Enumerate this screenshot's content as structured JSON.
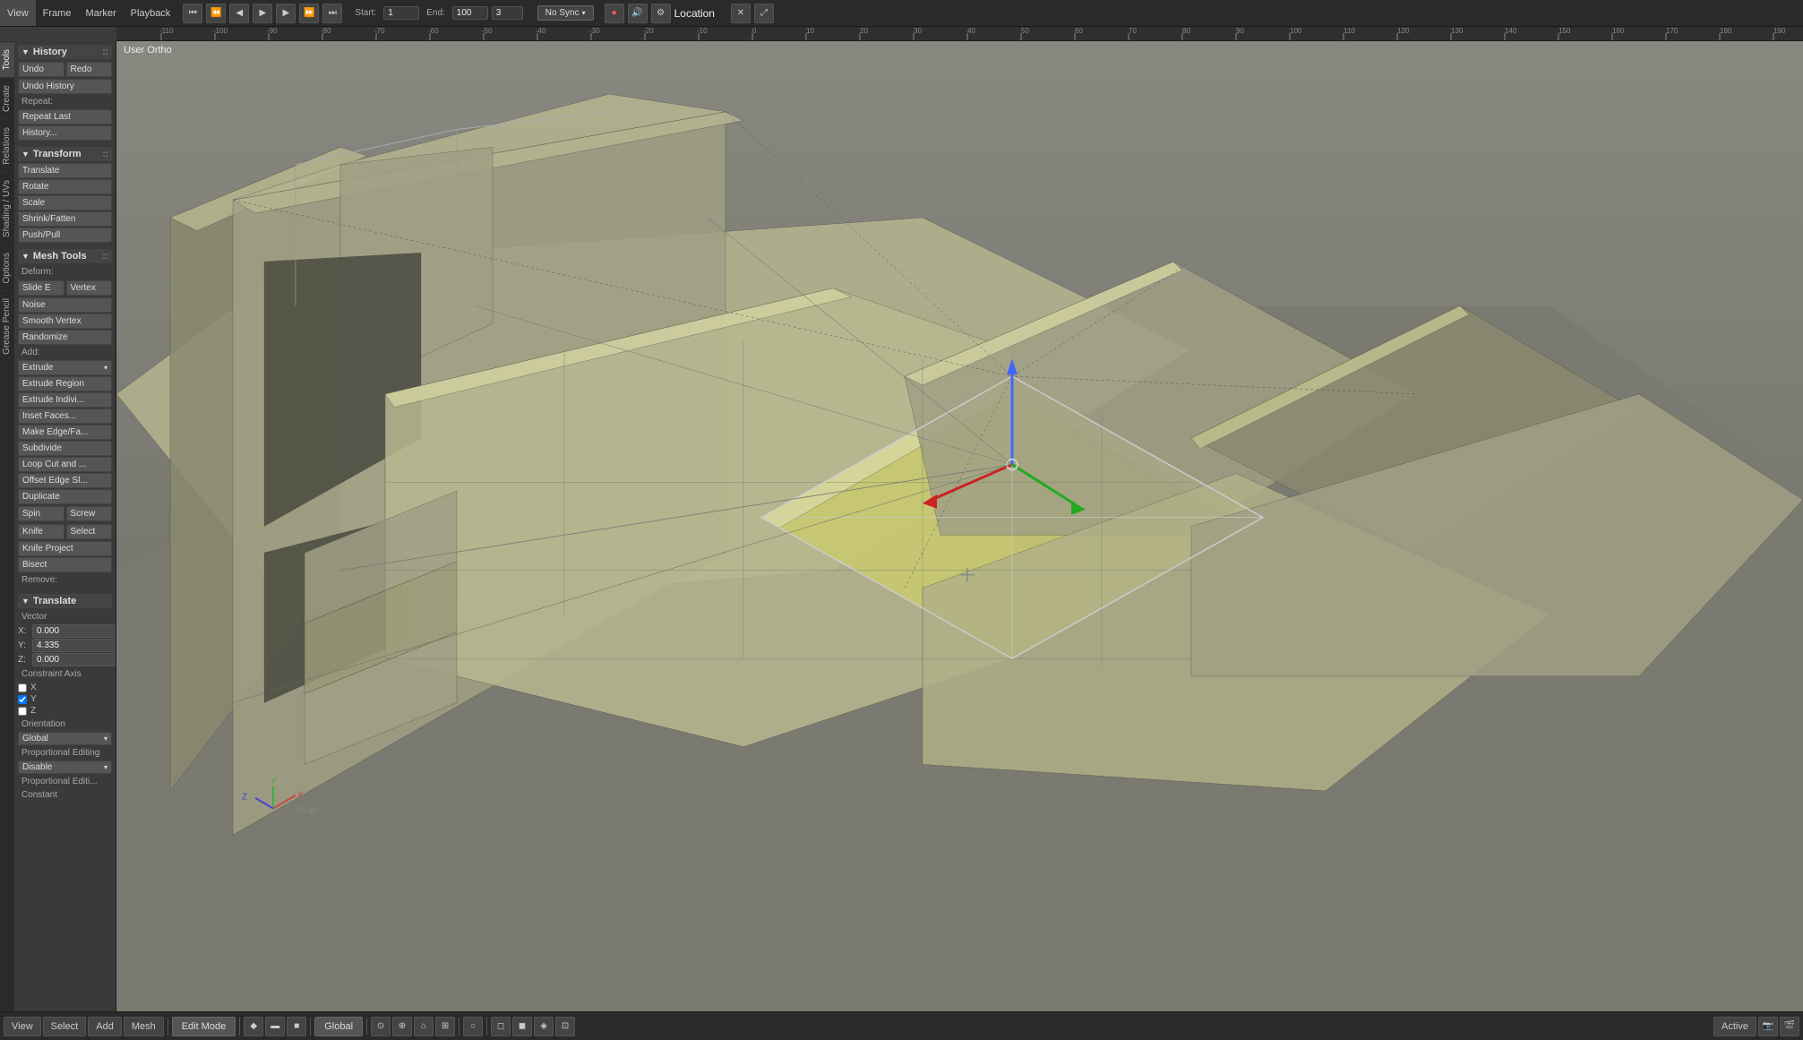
{
  "topbar": {
    "menus": [
      "View",
      "Frame",
      "Marker",
      "Playback"
    ],
    "start_label": "Start:",
    "start_val": "1",
    "end_label": "End:",
    "end_val": "100",
    "frame_val": "3",
    "sync_label": "No Sync",
    "location_label": "Location",
    "view_label": "User Ortho"
  },
  "sidebar": {
    "history_header": "History",
    "undo_label": "Undo",
    "redo_label": "Redo",
    "undo_history_label": "Undo History",
    "repeat_label": "Repeat:",
    "repeat_last_label": "Repeat Last",
    "history_dots_label": "History...",
    "transform_header": "Transform",
    "translate_label": "Translate",
    "rotate_label": "Rotate",
    "scale_label": "Scale",
    "shrink_fatten_label": "Shrink/Fatten",
    "push_pull_label": "Push/Pull",
    "mesh_tools_header": "Mesh Tools",
    "deform_label": "Deform:",
    "slide_e_label": "Slide E",
    "vertex_label": "Vertex",
    "noise_label": "Noise",
    "smooth_vertex_label": "Smooth Vertex",
    "randomize_label": "Randomize",
    "add_label": "Add:",
    "extrude_label": "Extrude",
    "extrude_region_label": "Extrude Region",
    "extrude_indiv_label": "Extrude Indivi...",
    "inset_faces_label": "Inset Faces...",
    "make_edge_fa_label": "Make Edge/Fa...",
    "subdivide_label": "Subdivide",
    "loop_cut_label": "Loop Cut and ...",
    "offset_edge_label": "Offset Edge Sl...",
    "duplicate_label": "Duplicate",
    "spin_label": "Spin",
    "screw_label": "Screw",
    "knife_label": "Knife",
    "select_label": "Select",
    "knife_project_label": "Knife Project",
    "bisect_label": "Bisect",
    "remove_label": "Remove:",
    "translate_section": "Translate",
    "vector_label": "Vector",
    "x_label": "X:",
    "x_val": "0.000",
    "y_label": "Y:",
    "y_val": "4.335",
    "z_label": "Z:",
    "z_val": "0.000",
    "constraint_axis_label": "Constraint Axis",
    "x_axis_label": "X",
    "y_axis_label": "Y",
    "z_axis_label": "Z",
    "orientation_label": "Orientation",
    "global_label": "Global",
    "proportional_editing_label": "Proportional Editing",
    "disable_label": "Disable",
    "proportional_edit_label": "Proportional Editi..."
  },
  "vtabs": [
    "Tools",
    "Create",
    "Relations",
    "Shading / UVs",
    "Options",
    "Grease Pencil"
  ],
  "bottom": {
    "view_label": "View",
    "select_label": "Select",
    "add_label": "Add",
    "mesh_label": "Mesh",
    "edit_mode_label": "Edit Mode",
    "global_label": "Global",
    "active_label": "Active",
    "mode_label": "(3) aa"
  }
}
